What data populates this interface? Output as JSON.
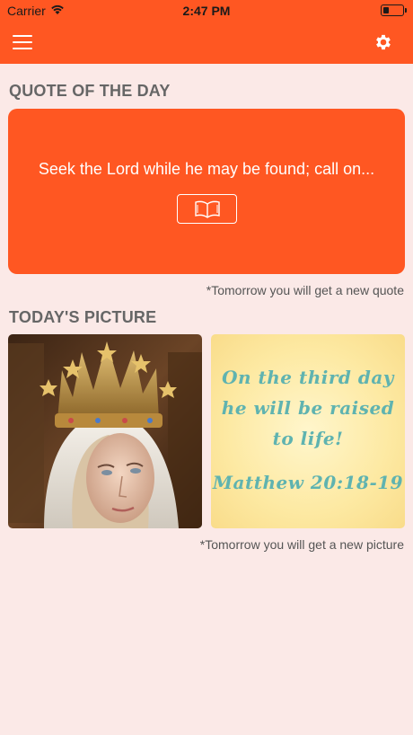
{
  "status_bar": {
    "carrier": "Carrier",
    "time": "2:47 PM",
    "battery_level": 0.2
  },
  "nav": {
    "menu_icon": "hamburger-menu-icon",
    "settings_icon": "gear-icon"
  },
  "quote_section": {
    "title": "QUOTE OF THE DAY",
    "quote_text": "Seek the Lord while he may be found; call on...",
    "book_icon": "open-book-icon",
    "note": "*Tomorrow you will get a new quote"
  },
  "picture_section": {
    "title": "TODAY'S PICTURE",
    "image_left": "crowned-virgin-mary-statue-photo",
    "verse_lines": [
      "On the third day",
      "he will be raised",
      "to life!"
    ],
    "verse_ref": "Matthew 20:18-19",
    "note": "*Tomorrow you will get a new picture"
  },
  "colors": {
    "accent": "#ff5722",
    "background": "#fbe9e7",
    "verse_text": "#5fb3b0"
  }
}
